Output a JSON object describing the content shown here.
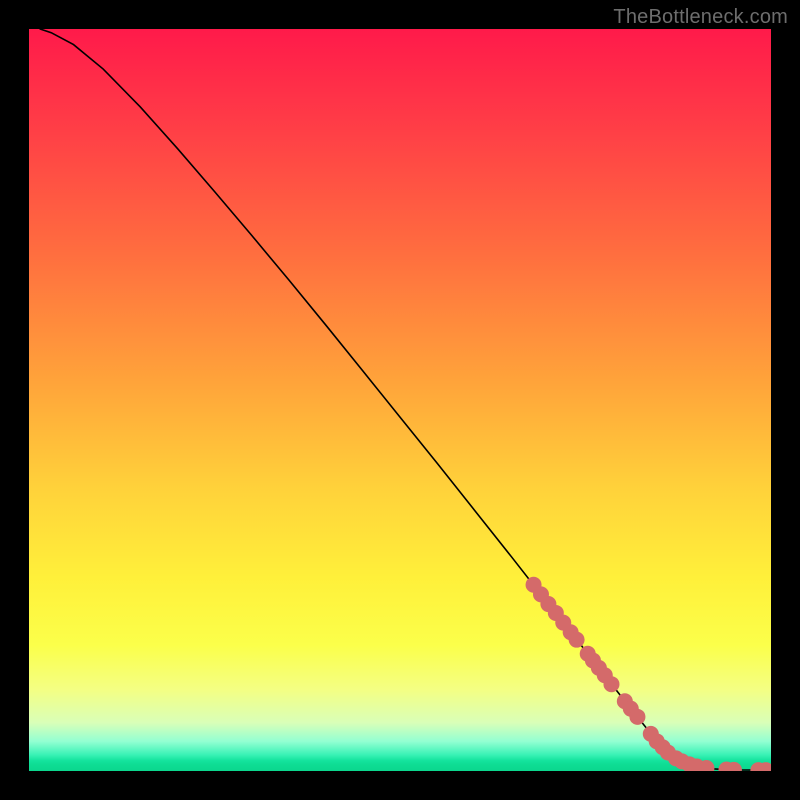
{
  "watermark": "TheBottleneck.com",
  "chart_data": {
    "type": "line",
    "title": "",
    "xlabel": "",
    "ylabel": "",
    "xlim": [
      0,
      100
    ],
    "ylim": [
      0,
      100
    ],
    "curve_description": "Monotonically decreasing curve from top-left to bottom-right, flattening to near-zero at the right edge. Gradient background encodes value (red high → green low).",
    "curve": [
      {
        "x": 1.5,
        "y": 100.0
      },
      {
        "x": 3.0,
        "y": 99.5
      },
      {
        "x": 6.0,
        "y": 97.9
      },
      {
        "x": 10.0,
        "y": 94.6
      },
      {
        "x": 15.0,
        "y": 89.5
      },
      {
        "x": 20.0,
        "y": 83.9
      },
      {
        "x": 25.0,
        "y": 78.1
      },
      {
        "x": 30.0,
        "y": 72.2
      },
      {
        "x": 35.0,
        "y": 66.2
      },
      {
        "x": 40.0,
        "y": 60.1
      },
      {
        "x": 45.0,
        "y": 53.9
      },
      {
        "x": 50.0,
        "y": 47.7
      },
      {
        "x": 55.0,
        "y": 41.5
      },
      {
        "x": 60.0,
        "y": 35.2
      },
      {
        "x": 65.0,
        "y": 28.9
      },
      {
        "x": 70.0,
        "y": 22.5
      },
      {
        "x": 75.0,
        "y": 16.2
      },
      {
        "x": 80.0,
        "y": 9.8
      },
      {
        "x": 82.0,
        "y": 7.3
      },
      {
        "x": 84.0,
        "y": 4.8
      },
      {
        "x": 86.0,
        "y": 2.7
      },
      {
        "x": 87.0,
        "y": 1.9
      },
      {
        "x": 88.0,
        "y": 1.3
      },
      {
        "x": 89.0,
        "y": 0.9
      },
      {
        "x": 90.0,
        "y": 0.6
      },
      {
        "x": 92.0,
        "y": 0.3
      },
      {
        "x": 95.0,
        "y": 0.15
      },
      {
        "x": 100.0,
        "y": 0.12
      }
    ],
    "series": [
      {
        "name": "highlighted-points",
        "color": "#d46a6a",
        "points": [
          {
            "x": 68.0,
            "y": 25.1
          },
          {
            "x": 69.0,
            "y": 23.8
          },
          {
            "x": 70.0,
            "y": 22.5
          },
          {
            "x": 71.0,
            "y": 21.3
          },
          {
            "x": 72.0,
            "y": 20.0
          },
          {
            "x": 73.0,
            "y": 18.7
          },
          {
            "x": 73.8,
            "y": 17.7
          },
          {
            "x": 75.3,
            "y": 15.8
          },
          {
            "x": 76.0,
            "y": 14.9
          },
          {
            "x": 76.8,
            "y": 13.9
          },
          {
            "x": 77.6,
            "y": 12.9
          },
          {
            "x": 78.5,
            "y": 11.7
          },
          {
            "x": 80.3,
            "y": 9.4
          },
          {
            "x": 81.1,
            "y": 8.4
          },
          {
            "x": 82.0,
            "y": 7.3
          },
          {
            "x": 83.8,
            "y": 5.0
          },
          {
            "x": 84.6,
            "y": 4.0
          },
          {
            "x": 85.4,
            "y": 3.2
          },
          {
            "x": 86.1,
            "y": 2.5
          },
          {
            "x": 87.2,
            "y": 1.7
          },
          {
            "x": 88.0,
            "y": 1.3
          },
          {
            "x": 89.0,
            "y": 0.9
          },
          {
            "x": 90.0,
            "y": 0.6
          },
          {
            "x": 91.3,
            "y": 0.4
          },
          {
            "x": 94.0,
            "y": 0.2
          },
          {
            "x": 95.0,
            "y": 0.15
          },
          {
            "x": 98.3,
            "y": 0.12
          },
          {
            "x": 99.3,
            "y": 0.12
          }
        ]
      }
    ]
  }
}
